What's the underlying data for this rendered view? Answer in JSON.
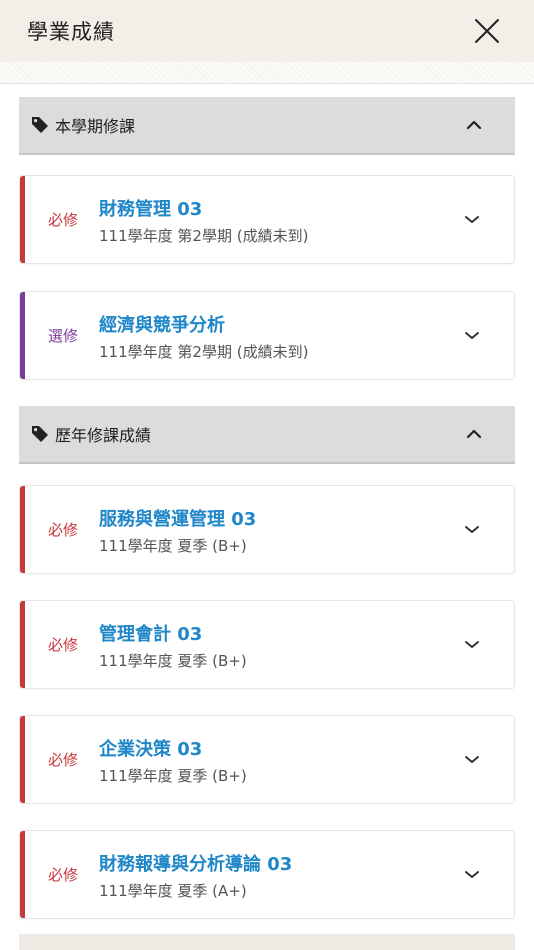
{
  "header": {
    "title": "學業成績"
  },
  "sections": [
    {
      "title": "本學期修課",
      "items": [
        {
          "type": "必修",
          "type_color": "#c8383f",
          "name": "財務管理 03",
          "info": "111學年度 第2學期 (成績未到)"
        },
        {
          "type": "選修",
          "type_color": "#7e3b9c",
          "name": "經濟與競爭分析",
          "info": "111學年度 第2學期 (成績未到)"
        }
      ]
    },
    {
      "title": "歷年修課成績",
      "items": [
        {
          "type": "必修",
          "type_color": "#c8383f",
          "name": "服務與營運管理 03",
          "info": "111學年度 夏季 (B+)"
        },
        {
          "type": "必修",
          "type_color": "#c8383f",
          "name": "管理會計 03",
          "info": "111學年度 夏季 (B+)"
        },
        {
          "type": "必修",
          "type_color": "#c8383f",
          "name": "企業決策 03",
          "info": "111學年度 夏季 (B+)"
        },
        {
          "type": "必修",
          "type_color": "#c8383f",
          "name": "財務報導與分析導論 03",
          "info": "111學年度 夏季 (A+)"
        }
      ]
    }
  ],
  "icons": {
    "close": "close-icon",
    "section": "tag-icon",
    "collapse": "chevron-up-icon",
    "expand": "chevron-down-icon"
  }
}
